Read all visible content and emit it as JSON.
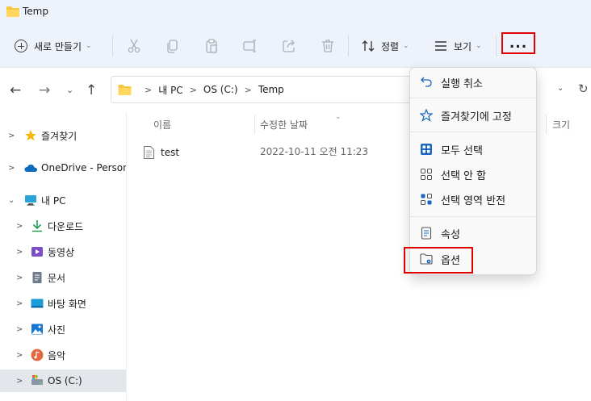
{
  "window": {
    "title": "Temp"
  },
  "toolbar": {
    "new_label": "새로 만들기",
    "sort_label": "정렬",
    "view_label": "보기",
    "more_label": "..."
  },
  "address": {
    "crumbs": [
      "내 PC",
      "OS (C:)",
      "Temp"
    ]
  },
  "sidebar": {
    "items": [
      {
        "label": "즐겨찾기",
        "icon": "star-icon"
      },
      {
        "label": "OneDrive - Persona",
        "icon": "cloud-icon"
      },
      {
        "label": "내 PC",
        "icon": "pc-icon"
      },
      {
        "label": "다운로드",
        "icon": "download-icon"
      },
      {
        "label": "동영상",
        "icon": "video-icon"
      },
      {
        "label": "문서",
        "icon": "document-icon"
      },
      {
        "label": "바탕 화면",
        "icon": "desktop-icon"
      },
      {
        "label": "사진",
        "icon": "picture-icon"
      },
      {
        "label": "음악",
        "icon": "music-icon"
      },
      {
        "label": "OS (C:)",
        "icon": "drive-icon"
      }
    ]
  },
  "content": {
    "columns": [
      "이름",
      "수정한 날짜",
      "크기"
    ],
    "files": [
      {
        "name": "test",
        "modified": "2022-10-11 오전 11:23"
      }
    ]
  },
  "menu": {
    "items": [
      {
        "label": "실행 취소",
        "icon": "undo-icon"
      },
      {
        "label": "즐겨찾기에 고정",
        "icon": "star-outline-icon"
      },
      {
        "label": "모두 선택",
        "icon": "select-all-icon"
      },
      {
        "label": "선택 안 함",
        "icon": "select-none-icon"
      },
      {
        "label": "선택 영역 반전",
        "icon": "invert-selection-icon"
      },
      {
        "label": "속성",
        "icon": "properties-icon"
      },
      {
        "label": "옵션",
        "icon": "folder-options-icon"
      }
    ]
  },
  "colors": {
    "accent": "#0067c0",
    "highlight": "#e00000",
    "toolbar_bg": "#eef3fb"
  }
}
